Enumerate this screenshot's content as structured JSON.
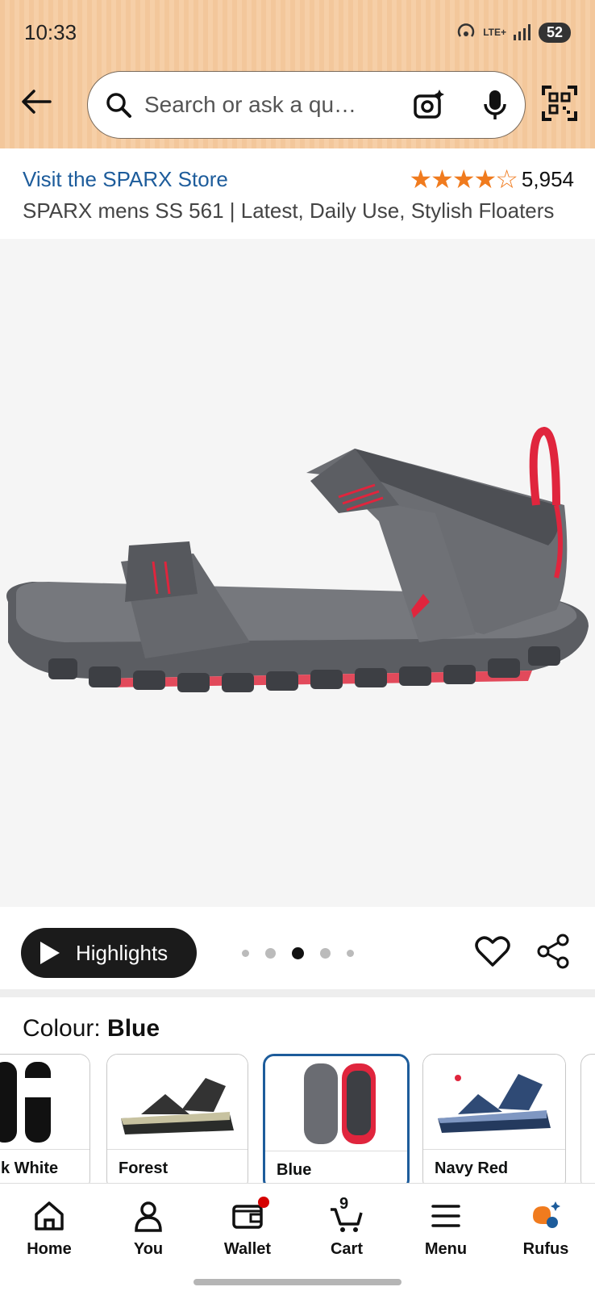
{
  "status": {
    "time": "10:33",
    "network": "LTE+",
    "battery": "52"
  },
  "search": {
    "placeholder": "Search or ask a qu…"
  },
  "store": {
    "link": "Visit the SPARX Store",
    "rating_count": "5,954",
    "rating_value": 4.0,
    "stars": "★★★★☆"
  },
  "product": {
    "title": "SPARX mens SS 561 | Latest, Daily Use, Stylish Floaters"
  },
  "actions": {
    "highlights_label": "Highlights"
  },
  "carousel": {
    "count": 5,
    "active_index": 2
  },
  "colour": {
    "label": "Colour: ",
    "selected": "Blue"
  },
  "swatches": [
    {
      "name": "k White"
    },
    {
      "name": "Forest"
    },
    {
      "name": "Blue"
    },
    {
      "name": "Navy Red"
    }
  ],
  "nav": {
    "home": "Home",
    "you": "You",
    "wallet": "Wallet",
    "cart": "Cart",
    "cart_count": "9",
    "menu": "Menu",
    "rufus": "Rufus"
  },
  "colors": {
    "accent_link": "#1d5c9b",
    "star": "#f07b1e",
    "header": "#f3c79b"
  }
}
